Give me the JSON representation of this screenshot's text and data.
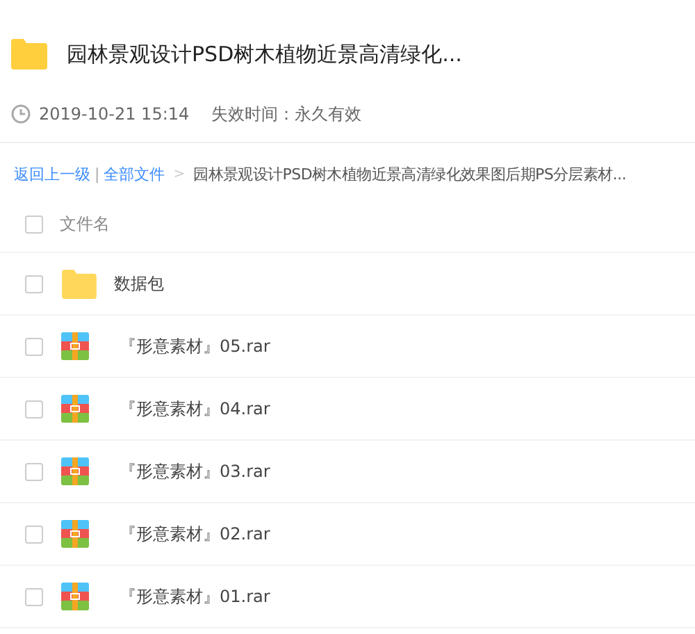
{
  "title": "园林景观设计PSD树木植物近景高清绿化...",
  "meta": {
    "time": "2019-10-21 15:14",
    "expiry": "失效时间：永久有效"
  },
  "breadcrumb": {
    "back": "返回上一级",
    "separator": "|",
    "root": "全部文件",
    "arrow": ">",
    "current": "园林景观设计PSD树木植物近景高清绿化效果图后期PS分层素材..."
  },
  "table": {
    "header": {
      "label": "文件名",
      "checked": false
    },
    "rows": [
      {
        "kind": "folder",
        "name": "数据包",
        "checked": false
      },
      {
        "kind": "archive",
        "name": "『形意素材』05.rar",
        "checked": false
      },
      {
        "kind": "archive",
        "name": "『形意素材』04.rar",
        "checked": false
      },
      {
        "kind": "archive",
        "name": "『形意素材』03.rar",
        "checked": false
      },
      {
        "kind": "archive",
        "name": "『形意素材』02.rar",
        "checked": false
      },
      {
        "kind": "archive",
        "name": "『形意素材』01.rar",
        "checked": false
      }
    ]
  }
}
